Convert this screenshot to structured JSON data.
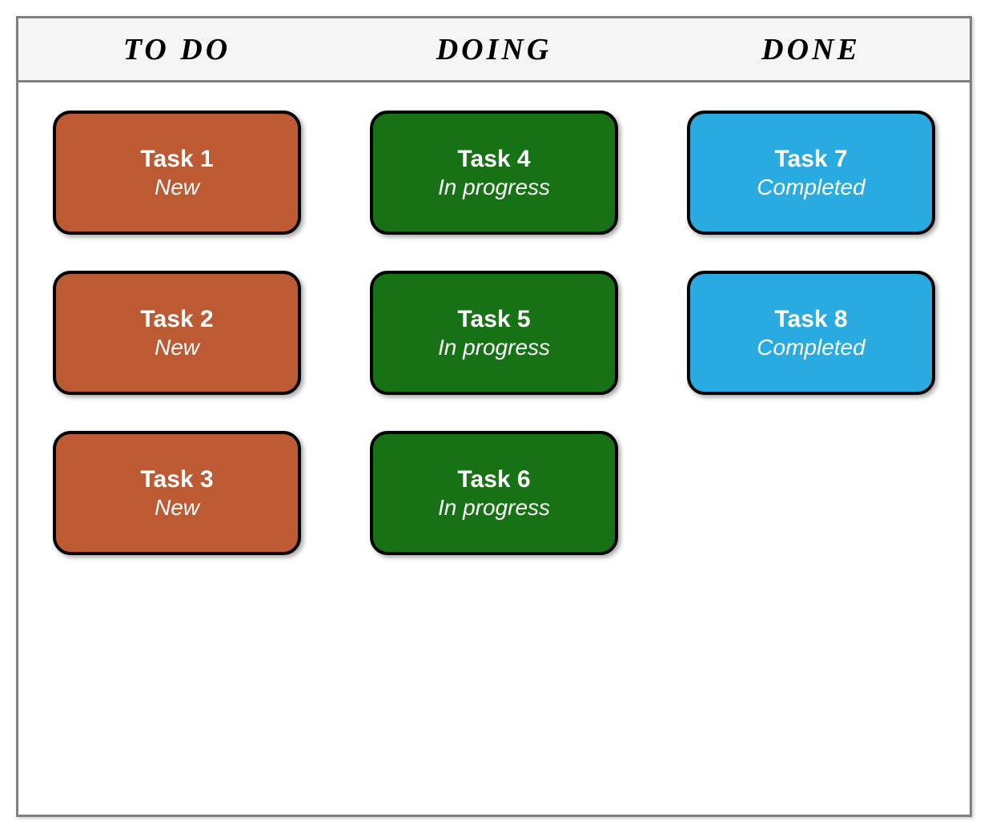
{
  "board": {
    "columns": [
      {
        "header": "TO DO",
        "color": "#bb5a33",
        "cards": [
          {
            "title": "Task 1",
            "status": "New"
          },
          {
            "title": "Task 2",
            "status": "New"
          },
          {
            "title": "Task 3",
            "status": "New"
          }
        ]
      },
      {
        "header": "DOING",
        "color": "#177216",
        "cards": [
          {
            "title": "Task 4",
            "status": "In progress"
          },
          {
            "title": "Task 5",
            "status": "In progress"
          },
          {
            "title": "Task 6",
            "status": "In progress"
          }
        ]
      },
      {
        "header": "DONE",
        "color": "#29abe2",
        "cards": [
          {
            "title": "Task 7",
            "status": "Completed"
          },
          {
            "title": "Task 8",
            "status": "Completed"
          }
        ]
      }
    ]
  }
}
